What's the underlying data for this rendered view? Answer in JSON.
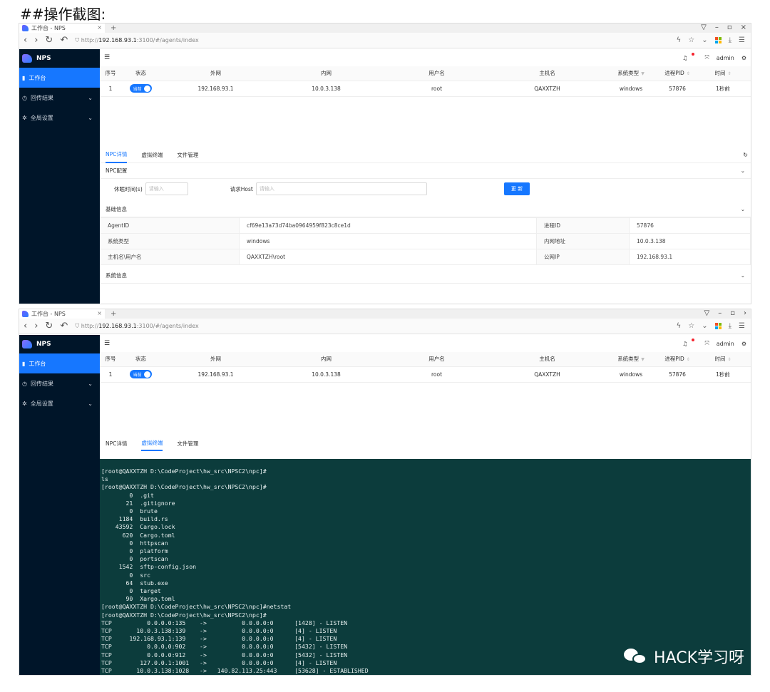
{
  "heading": "##操作截图:",
  "browser": {
    "tab_title": "工作台 - NPS",
    "tab_close": "×",
    "tab_new": "+",
    "url_prefix": "http://",
    "url_host": "192.168.93.1",
    "url_rest": ":3100/#/agents/index",
    "url_rest2": ":3100/#/agents/index"
  },
  "app": {
    "brand": "NPS",
    "menu": [
      {
        "label": "工作台",
        "icon": "dashboard-icon"
      },
      {
        "label": "回传结果",
        "icon": "clock-icon"
      },
      {
        "label": "全局设置",
        "icon": "gear-icon"
      }
    ],
    "user": "admin",
    "menu_toggle_icon": "☰"
  },
  "table": {
    "headers": [
      "序号",
      "状态",
      "外网",
      "内网",
      "用户名",
      "主机名",
      "系统类型",
      "进程PID",
      "时间"
    ],
    "row": {
      "index": "1",
      "status": "当前",
      "wan": "192.168.93.1",
      "lan": "10.0.3.138",
      "user": "root",
      "host": "QAXXTZH",
      "os": "windows",
      "pid": "57876",
      "time": "1秒前"
    }
  },
  "tabs": [
    "NPC详情",
    "虚拟终端",
    "文件管理"
  ],
  "npc_config": {
    "title": "NPC配置",
    "sleep_label": "休眠时间(s)",
    "sleep_placeholder": "请输入",
    "host_label": "请求Host",
    "host_placeholder": "请输入",
    "update_btn": "更 新"
  },
  "basic_info": {
    "title": "基础信息",
    "rows": [
      {
        "k1": "AgentID",
        "v1": "cf69e13a73d74ba0964959f823c8ce1d",
        "k2": "进程ID",
        "v2": "57876"
      },
      {
        "k1": "系统类型",
        "v1": "windows",
        "k2": "内网地址",
        "v2": "10.0.3.138"
      },
      {
        "k1": "主机名\\用户名",
        "v1": "QAXXTZH\\root",
        "k2": "公网IP",
        "v2": "192.168.93.1"
      }
    ]
  },
  "system_info": {
    "title": "系统信息"
  },
  "terminal": {
    "lines": "[root@QAXXTZH D:\\CodeProject\\hw_src\\NPSC2\\npc]#\nls\n[root@QAXXTZH D:\\CodeProject\\hw_src\\NPSC2\\npc]#\n        0  .git\n       21  .gitignore\n        0  brute\n     1184  build.rs\n    43592  Cargo.lock\n      620  Cargo.toml\n        0  httpscan\n        0  platform\n        0  portscan\n     1542  sftp-config.json\n        0  src\n       64  stub.exe\n        0  target\n       90  Xargo.toml\n[root@QAXXTZH D:\\CodeProject\\hw_src\\NPSC2\\npc]#netstat\n[root@QAXXTZH D:\\CodeProject\\hw_src\\NPSC2\\npc]#\nTCP          0.0.0.0:135    ->          0.0.0.0:0      [1428] - LISTEN\nTCP       10.0.3.138:139    ->          0.0.0.0:0      [4] - LISTEN\nTCP     192.168.93.1:139    ->          0.0.0.0:0      [4] - LISTEN\nTCP          0.0.0.0:902    ->          0.0.0.0:0      [5432] - LISTEN\nTCP          0.0.0.0:912    ->          0.0.0.0:0      [5432] - LISTEN\nTCP        127.0.0.1:1001   ->          0.0.0.0:0      [4] - LISTEN\nTCP       10.0.3.138:1028   ->   140.82.113.25:443     [53628] - ESTABLISHED"
  },
  "watermark": "HACK学习呀",
  "colors": {
    "primary": "#1677ff",
    "sidebar": "#001529",
    "terminal_bg": "#0c3c3c"
  }
}
